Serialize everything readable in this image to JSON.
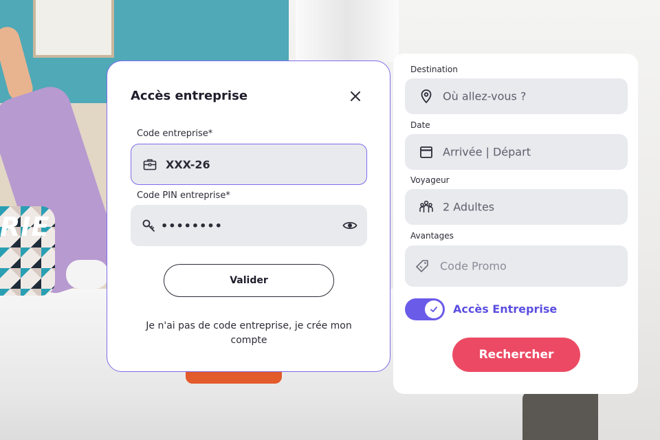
{
  "background": {
    "brand_fragment": "RIE"
  },
  "modal": {
    "title": "Accès entreprise",
    "code_label": "Code entreprise*",
    "code_value": "XXX-26",
    "pin_label": "Code PIN entreprise*",
    "pin_value": "••••••••",
    "validate_label": "Valider",
    "create_account_text": "Je n'ai pas de code entreprise, je crée mon compte",
    "close_icon": "close-icon",
    "accent_color": "#7d6bea"
  },
  "search": {
    "destination_label": "Destination",
    "destination_placeholder": "Où allez-vous ?",
    "date_label": "Date",
    "date_placeholder": "Arrivée | Départ",
    "traveler_label": "Voyageur",
    "traveler_value": "2 Adultes",
    "perks_label": "Avantages",
    "promo_placeholder": "Code Promo",
    "business_toggle_label": "Accès Entreprise",
    "business_toggle_on": true,
    "search_button": "Rechercher",
    "button_color": "#ec4a64",
    "toggle_color": "#6a5be8"
  }
}
